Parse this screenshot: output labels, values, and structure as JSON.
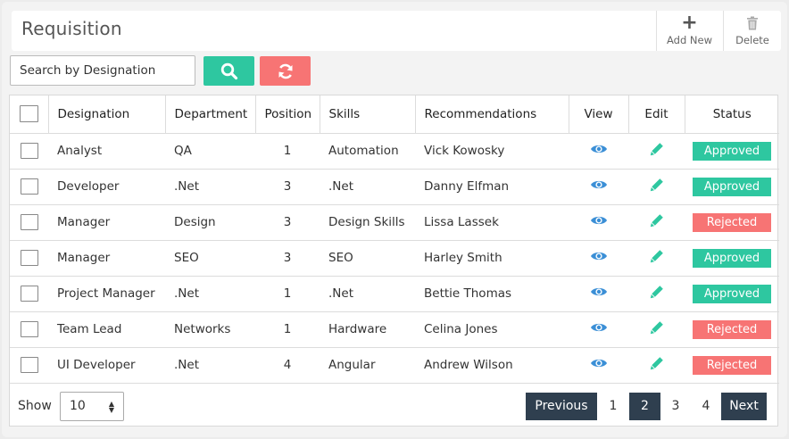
{
  "header": {
    "title": "Requisition",
    "add_label": "Add New",
    "delete_label": "Delete"
  },
  "toolbar": {
    "search_placeholder": "Search by Designation",
    "search_icon": "search-icon",
    "reset_icon": "refresh-icon"
  },
  "table": {
    "columns": [
      "Designation",
      "Department",
      "Position",
      "Skills",
      "Recommendations",
      "View",
      "Edit",
      "Status"
    ],
    "rows": [
      {
        "designation": "Analyst",
        "department": "QA",
        "position": "1",
        "skills": "Automation",
        "recommendation": "Vick Kowosky",
        "status": "Approved"
      },
      {
        "designation": "Developer",
        "department": ".Net",
        "position": "3",
        "skills": ".Net",
        "recommendation": "Danny Elfman",
        "status": "Approved"
      },
      {
        "designation": "Manager",
        "department": "Design",
        "position": "3",
        "skills": "Design Skills",
        "recommendation": "Lissa Lassek",
        "status": "Rejected"
      },
      {
        "designation": "Manager",
        "department": "SEO",
        "position": "3",
        "skills": "SEO",
        "recommendation": "Harley Smith",
        "status": "Approved"
      },
      {
        "designation": "Project Manager",
        "department": ".Net",
        "position": "1",
        "skills": ".Net",
        "recommendation": "Bettie Thomas",
        "status": "Approved"
      },
      {
        "designation": "Team Lead",
        "department": "Networks",
        "position": "1",
        "skills": "Hardware",
        "recommendation": "Celina Jones",
        "status": "Rejected"
      },
      {
        "designation": "UI Developer",
        "department": ".Net",
        "position": "4",
        "skills": "Angular",
        "recommendation": "Andrew Wilson",
        "status": "Rejected"
      }
    ]
  },
  "footer": {
    "show_label": "Show",
    "page_size": "10",
    "previous_label": "Previous",
    "next_label": "Next",
    "pages": [
      "1",
      "2",
      "3",
      "4"
    ],
    "current_page": "2"
  },
  "colors": {
    "accent_green": "#2ec7a0",
    "accent_red": "#f77474",
    "view_icon": "#3b8fd6",
    "edit_icon": "#2ec7a0",
    "pager_dark": "#2f3f4f"
  }
}
